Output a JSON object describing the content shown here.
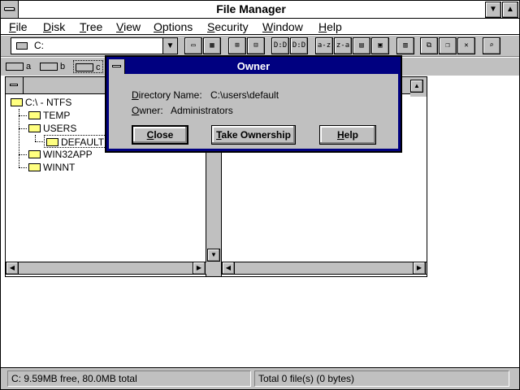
{
  "app": {
    "title": "File Manager"
  },
  "menu": [
    {
      "acc": "F",
      "rest": "ile"
    },
    {
      "acc": "D",
      "rest": "isk"
    },
    {
      "acc": "T",
      "rest": "ree"
    },
    {
      "acc": "V",
      "rest": "iew"
    },
    {
      "acc": "O",
      "rest": "ptions"
    },
    {
      "acc": "S",
      "rest": "ecurity"
    },
    {
      "acc": "W",
      "rest": "indow"
    },
    {
      "acc": "H",
      "rest": "elp"
    }
  ],
  "toolbar": {
    "drive_value": "C:",
    "buttons": [
      "D:D",
      "D:D",
      "a-z",
      "z-a"
    ]
  },
  "drives": [
    {
      "letter": "a"
    },
    {
      "letter": "b"
    },
    {
      "letter": "c"
    }
  ],
  "tree": {
    "root": "C:\\ - NTFS",
    "items": [
      "TEMP",
      "USERS",
      "DEFAULT",
      "WIN32APP",
      "WINNT"
    ]
  },
  "status": {
    "left": "C: 9.59MB free,  80.0MB total",
    "right": "Total 0 file(s) (0 bytes)"
  },
  "dialog": {
    "title": "Owner",
    "dir_label_acc": "D",
    "dir_label_rest": "irectory Name:",
    "dir_value": "C:\\users\\default",
    "owner_label_acc": "O",
    "owner_label_rest": "wner:",
    "owner_value": "Administrators",
    "close_acc": "C",
    "close_rest": "lose",
    "take_acc": "T",
    "take_rest": "ake Ownership",
    "help_acc": "H",
    "help_rest": "elp"
  }
}
